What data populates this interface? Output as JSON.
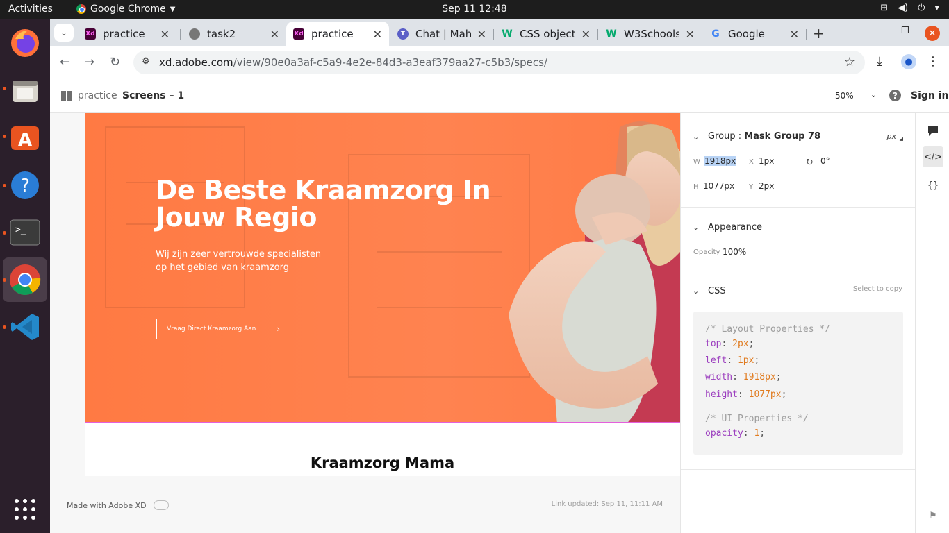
{
  "os": {
    "activities": "Activities",
    "app_name": "Google Chrome",
    "clock": "Sep 11  12:48"
  },
  "tabs": [
    {
      "title": "practice",
      "favicon": "adobe-xd-icon",
      "active": false
    },
    {
      "title": "task2",
      "favicon": "globe-icon",
      "active": false
    },
    {
      "title": "practice",
      "favicon": "adobe-xd-icon",
      "active": true
    },
    {
      "title": "Chat | Mahe",
      "favicon": "teams-icon",
      "active": false
    },
    {
      "title": "CSS object-",
      "favicon": "w3schools-icon",
      "active": false
    },
    {
      "title": "W3Schools",
      "favicon": "w3schools-icon",
      "active": false
    },
    {
      "title": "Google",
      "favicon": "google-icon",
      "active": false
    }
  ],
  "address": {
    "host": "xd.adobe.com",
    "path": "/view/90e0a3af-c5a9-4e2e-84d3-a3eaf379aa27-c5b3/specs/"
  },
  "xd": {
    "breadcrumb_project": "practice",
    "breadcrumb_screen": "Screens – 1",
    "zoom": "50%",
    "sign_in": "Sign in"
  },
  "hero": {
    "title": "De Beste Kraamzorg In Jouw Regio",
    "subtitle": "Wij zijn zeer vertrouwde specialisten op het gebied van kraamzorg",
    "button": "Vraag Direct Kraamzorg Aan",
    "section_title": "Kraamzorg Mama"
  },
  "canvas_footer": {
    "made_with": "Made with Adobe XD",
    "link_updated": "Link updated: Sep 11, 11:11 AM"
  },
  "inspect": {
    "group_label": "Group : ",
    "group_name": "Mask Group 78",
    "unit": "px",
    "w_label": "W",
    "w_value": "1918px",
    "x_label": "X",
    "x_value": "1px",
    "rotation": "0°",
    "h_label": "H",
    "h_value": "1077px",
    "y_label": "Y",
    "y_value": "2px",
    "appearance_title": "Appearance",
    "opacity_label": "Opacity",
    "opacity_value": "100%",
    "css_title": "CSS",
    "select_to_copy": "Select to copy",
    "code": {
      "comment1": "/* Layout Properties */",
      "top_prop": "top",
      "top_val": "2px",
      "left_prop": "left",
      "left_val": "1px",
      "width_prop": "width",
      "width_val": "1918px",
      "height_prop": "height",
      "height_val": "1077px",
      "comment2": "/* UI Properties */",
      "opacity_prop": "opacity",
      "opacity_val": "1"
    }
  },
  "colors": {
    "hero_orange": "#ff7a43",
    "selection_pink": "#e45fdc",
    "code_prop": "#9c3fbf",
    "code_value": "#e07b1f"
  }
}
